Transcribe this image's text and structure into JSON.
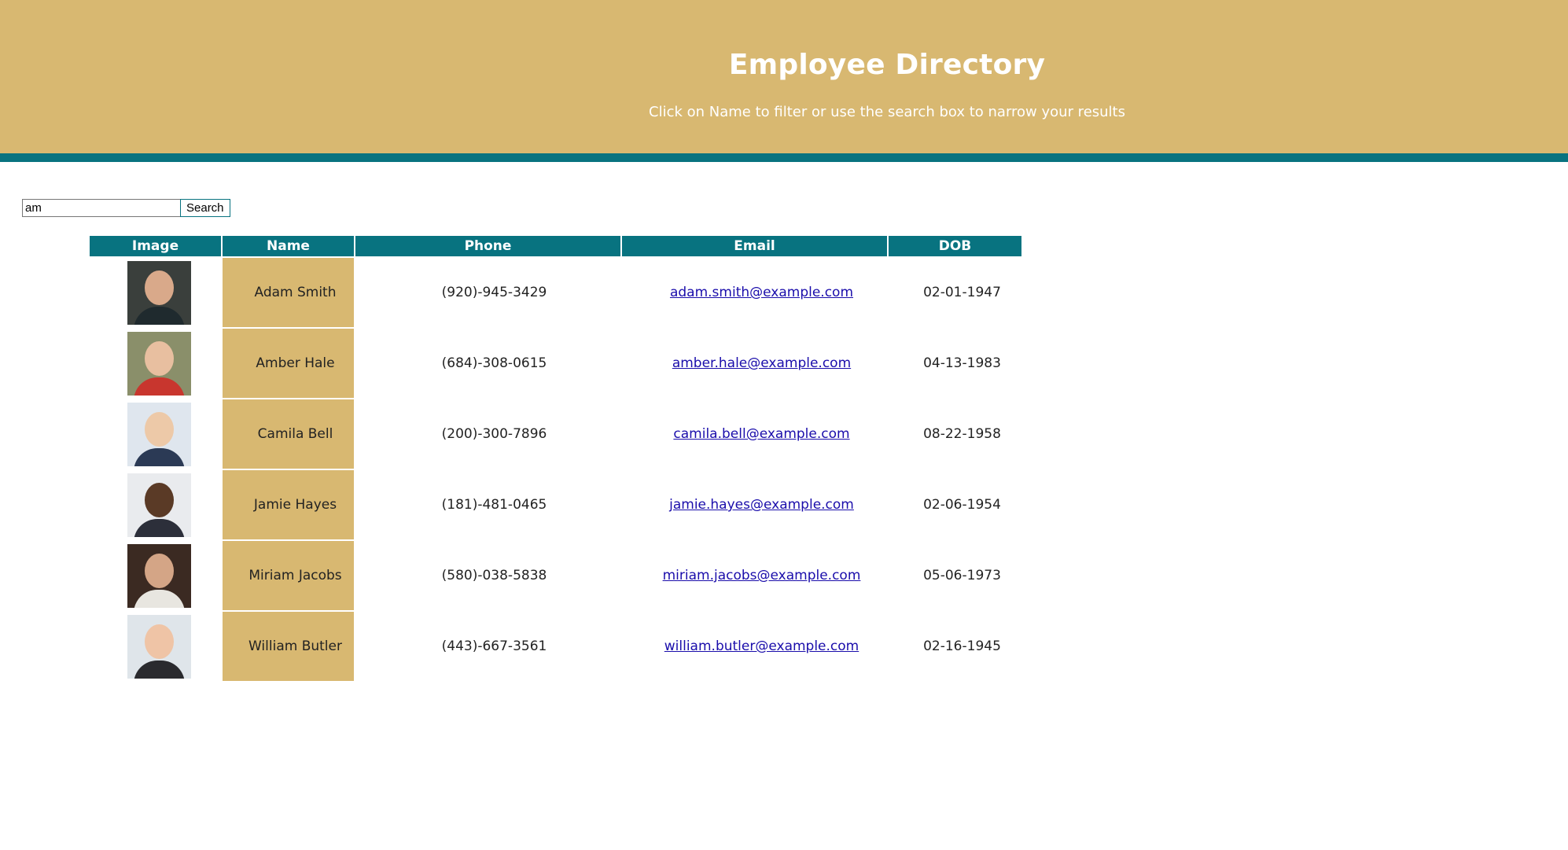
{
  "header": {
    "title": "Employee Directory",
    "subtitle": "Click on Name to filter or use the search box to narrow your results"
  },
  "search": {
    "value": "am",
    "button_label": "Search"
  },
  "table": {
    "headers": {
      "image": "Image",
      "name": "Name",
      "phone": "Phone",
      "email": "Email",
      "dob": "DOB"
    },
    "rows": [
      {
        "name": "Adam Smith",
        "phone": "(920)-945-3429",
        "email": "adam.smith@example.com",
        "dob": "02-01-1947"
      },
      {
        "name": "Amber Hale",
        "phone": "(684)-308-0615",
        "email": "amber.hale@example.com",
        "dob": "04-13-1983"
      },
      {
        "name": "Camila Bell",
        "phone": "(200)-300-7896",
        "email": "camila.bell@example.com",
        "dob": "08-22-1958"
      },
      {
        "name": "Jamie Hayes",
        "phone": "(181)-481-0465",
        "email": "jamie.hayes@example.com",
        "dob": "02-06-1954"
      },
      {
        "name": "Miriam Jacobs",
        "phone": "(580)-038-5838",
        "email": "miriam.jacobs@example.com",
        "dob": "05-06-1973"
      },
      {
        "name": "William Butler",
        "phone": "(443)-667-3561",
        "email": "william.butler@example.com",
        "dob": "02-16-1945"
      }
    ]
  },
  "colors": {
    "header_bg": "#d8b871",
    "accent": "#087380",
    "link": "#1a0dab"
  }
}
